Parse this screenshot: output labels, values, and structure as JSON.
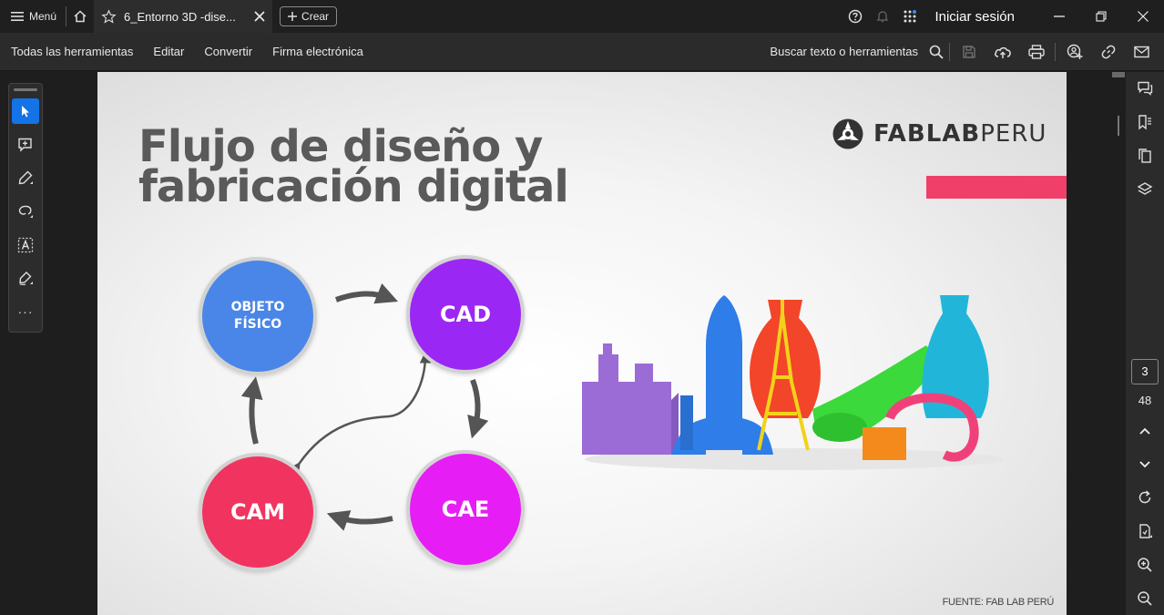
{
  "titlebar": {
    "menu_label": "Menú",
    "tab_title": "6_Entorno 3D -dise...",
    "create_label": "Crear",
    "signin_label": "Iniciar sesión"
  },
  "toolbar": {
    "items": [
      "Todas las herramientas",
      "Editar",
      "Convertir",
      "Firma electrónica"
    ],
    "search_label": "Buscar texto o herramientas"
  },
  "slide": {
    "title_line1": "Flujo de diseño y",
    "title_line2": "fabricación digital",
    "logo_bold": "FABLAB",
    "logo_light": "PERU",
    "nodes": {
      "objeto": "OBJETO FÍSICO",
      "cad": "CAD",
      "cae": "CAE",
      "cam": "CAM"
    },
    "source": "FUENTE: FAB LAB PERÚ",
    "colors": {
      "objeto": "#4a86e8",
      "cad": "#9b27f5",
      "cae": "#e61ef5",
      "cam": "#f0345f",
      "accent_bar": "#f0406a"
    }
  },
  "page_nav": {
    "current_page": "3",
    "total_pages": "48"
  }
}
